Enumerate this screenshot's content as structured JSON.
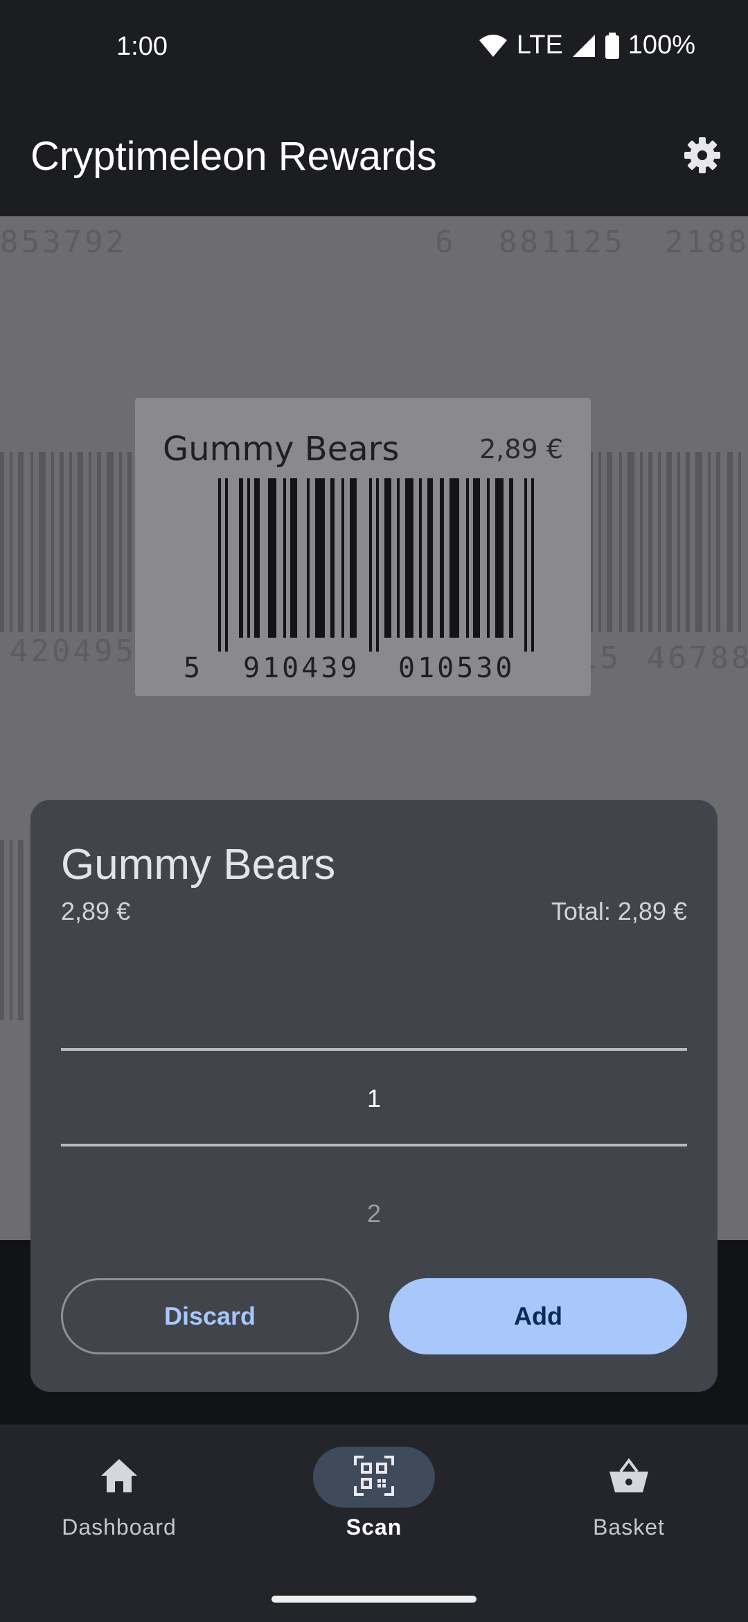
{
  "status_bar": {
    "time": "1:00",
    "network": "LTE",
    "battery": "100%"
  },
  "app_bar": {
    "title": "Cryptimeleon Rewards",
    "settings_icon": "gear-icon"
  },
  "camera_preview": {
    "background_codes": [
      "853792",
      "6",
      "881125",
      "2188",
      "420495",
      "15",
      "46788"
    ],
    "label": {
      "product_name": "Gummy Bears",
      "price": "2,89 €",
      "barcode_first_digit": "5",
      "barcode_left_digits": "910439",
      "barcode_right_digits": "010530"
    }
  },
  "sheet": {
    "product_name": "Gummy Bears",
    "unit_price": "2,89 €",
    "total": "Total: 2,89 €",
    "quantity_selected": "1",
    "quantity_next": "2",
    "discard_label": "Discard",
    "add_label": "Add"
  },
  "bottom_nav": {
    "items": [
      {
        "label": "Dashboard",
        "icon": "home-icon",
        "active": false
      },
      {
        "label": "Scan",
        "icon": "qr-code-scanner-icon",
        "active": true
      },
      {
        "label": "Basket",
        "icon": "basket-icon",
        "active": false
      }
    ]
  },
  "colors": {
    "accent": "#a8c7fa",
    "sheet_background": "#42444c",
    "nav_active_pill": "#3f4a5b"
  }
}
